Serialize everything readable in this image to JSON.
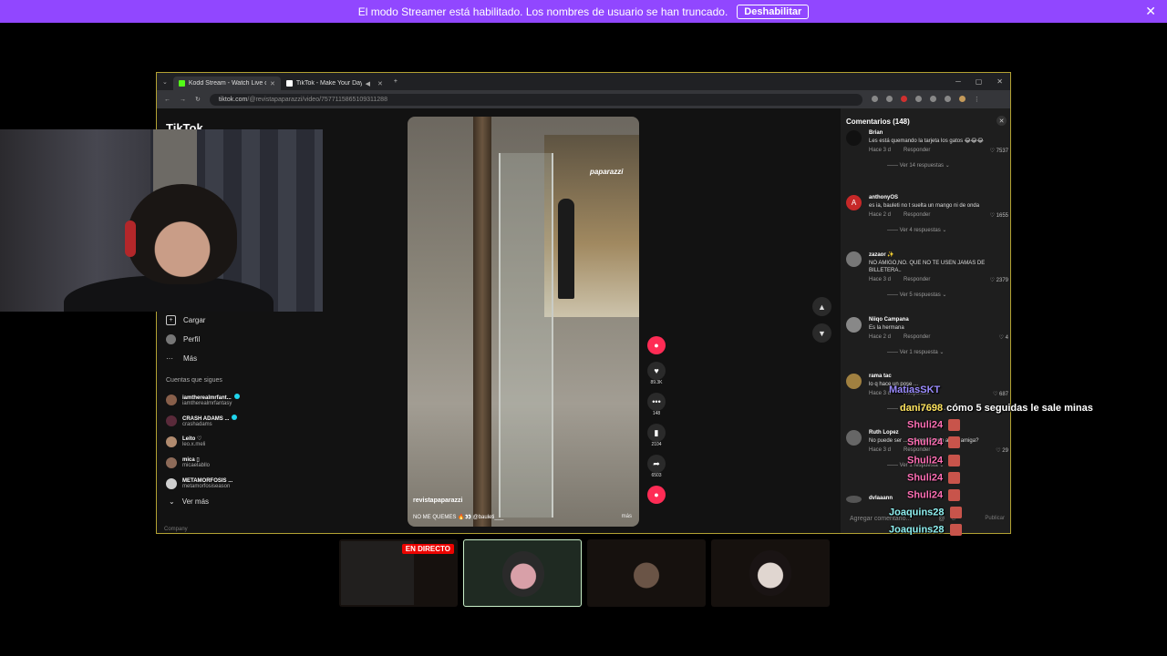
{
  "banner": {
    "text": "El modo Streamer está habilitado. Los nombres de usuario se han truncado.",
    "button": "Deshabilitar",
    "close": "✕"
  },
  "browser": {
    "tabs": [
      {
        "label": "Kodd Stream - Watch Live on K",
        "color": "#53fc18"
      },
      {
        "label": "TikTok - Make Your Day",
        "color": "#ffffff"
      }
    ],
    "url_host": "tiktok.com",
    "url_path": "/@revistapaparazzi/video/7577115865109311288"
  },
  "tiktok": {
    "logo": "TikTok",
    "nav": [
      {
        "label": "Cargar",
        "icon": "+"
      },
      {
        "label": "Perfil",
        "icon": ""
      },
      {
        "label": "Más",
        "icon": "···"
      }
    ],
    "following_title": "Cuentas que sigues",
    "following": [
      {
        "name": "iamtherealmrfant...",
        "handle": "iamtherealmrfantasy",
        "verified": true
      },
      {
        "name": "CRASH ADAMS ...",
        "handle": "crashadams",
        "verified": true
      },
      {
        "name": "Leito ♡",
        "handle": "leo.x.meli",
        "verified": false
      },
      {
        "name": "mica ▯",
        "handle": "micaelabllo",
        "verified": false
      },
      {
        "name": "METAMORFOSIS ...",
        "handle": "metamorfosiseason",
        "verified": false
      }
    ],
    "see_more": "Ver más",
    "company": "Company",
    "video": {
      "watermark": "paparazzi",
      "author": "revistapaparazzi",
      "caption": "NO ME QUEMES 🔥👀 @bauleti___",
      "more": "más"
    },
    "actions": [
      {
        "label": "",
        "icon": "●",
        "pink": true
      },
      {
        "label": "89.3K",
        "icon": "♥",
        "pink": false
      },
      {
        "label": "148",
        "icon": "•••",
        "pink": false
      },
      {
        "label": "2104",
        "icon": "▮",
        "pink": false
      },
      {
        "label": "6503",
        "icon": "➦",
        "pink": false
      },
      {
        "label": "",
        "icon": "●",
        "pink": true
      }
    ],
    "comments_title": "Comentarios (148)",
    "comments": [
      {
        "user": "Brian",
        "text": "Les está quemando la tarjeta los gatos 😂😂😂",
        "time": "Hace 3 d",
        "reply": "Responder",
        "likes": "♡ 7537",
        "replies": "—— Ver 14 respuestas ⌄",
        "avatar": "",
        "avcolor": "#111"
      },
      {
        "user": "anthonyOS",
        "text": "es ia, bauleti no t suelta un mango ni de onda",
        "time": "Hace 2 d",
        "reply": "Responder",
        "likes": "♡ 1655",
        "replies": "—— Ver 4 respuestas ⌄",
        "avatar": "A",
        "avcolor": "#c62828"
      },
      {
        "user": "zazaor ✨",
        "text": "NO AMIGO,NO. QUE NO TE USEN JAMAS DE BILLETERA..",
        "time": "Hace 3 d",
        "reply": "Responder",
        "likes": "♡ 2379",
        "replies": "—— Ver 5 respuestas ⌄",
        "avatar": "",
        "avcolor": "#777"
      },
      {
        "user": "Niiqo Campana",
        "text": "Es la hermana",
        "time": "Hace 2 d",
        "reply": "Responder",
        "likes": "♡ 4",
        "replies": "—— Ver 1 respuesta ⌄",
        "avatar": "",
        "avcolor": "#888"
      },
      {
        "user": "rama tac",
        "text": "lo q hace un pose ...",
        "time": "Hace 3 d",
        "reply": "Responder",
        "likes": "♡ 687",
        "replies": "—— Ver 3 respuestas ⌄",
        "avatar": "",
        "avcolor": "#a08040"
      },
      {
        "user": "Ruth Lopez",
        "text": "No puede ser ... acompañando a una amiga?",
        "time": "Hace 3 d",
        "reply": "Responder",
        "likes": "♡ 29",
        "replies": "—— Ver 1 respuesta ⌄",
        "avatar": "",
        "avcolor": "#666"
      },
      {
        "user": "dvlaaann",
        "text": "",
        "time": "",
        "reply": "",
        "likes": "",
        "replies": "",
        "avatar": "",
        "avcolor": "#555"
      }
    ],
    "comment_placeholder": "Agregar comentario...",
    "comment_at": "@",
    "publish": "Publicar"
  },
  "chat": [
    {
      "user": "MatiasSKT",
      "color": "#9b8cff",
      "msg": "",
      "badge": false
    },
    {
      "user": "dani7698",
      "color": "#ffe45e",
      "msg": "cómo 5 seguidas le sale minas",
      "badge": false
    },
    {
      "user": "Shuli24",
      "color": "#ff6fb5",
      "msg": "",
      "badge": true
    },
    {
      "user": "Shuli24",
      "color": "#ff6fb5",
      "msg": "",
      "badge": true
    },
    {
      "user": "Shuli24",
      "color": "#ff6fb5",
      "msg": "",
      "badge": true
    },
    {
      "user": "Shuli24",
      "color": "#ff6fb5",
      "msg": "",
      "badge": true
    },
    {
      "user": "Shuli24",
      "color": "#ff6fb5",
      "msg": "",
      "badge": true
    },
    {
      "user": "Joaquins28",
      "color": "#8ff0f0",
      "msg": "",
      "badge": true
    },
    {
      "user": "Joaquins28",
      "color": "#8ff0f0",
      "msg": "",
      "badge": true
    }
  ],
  "thumbs": {
    "live_label": "EN DIRECTO"
  }
}
